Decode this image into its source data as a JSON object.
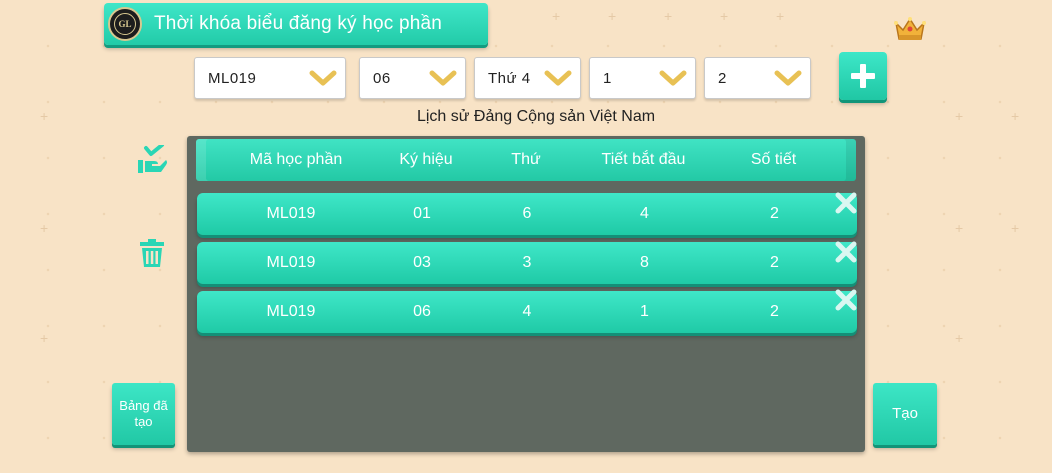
{
  "header": {
    "title": "Thời khóa biểu đăng ký học phần",
    "logo_text": "GL"
  },
  "selects": [
    {
      "value": "ML019"
    },
    {
      "value": "06"
    },
    {
      "value": "Thứ 4"
    },
    {
      "value": "1"
    },
    {
      "value": "2"
    }
  ],
  "course_name": "Lịch sử Đảng Cộng sản Việt Nam",
  "table": {
    "columns": [
      "Mã học phần",
      "Ký hiệu",
      "Thứ",
      "Tiết bắt đầu",
      "Số tiết"
    ],
    "rows": [
      [
        "ML019",
        "01",
        "6",
        "4",
        "2"
      ],
      [
        "ML019",
        "03",
        "3",
        "8",
        "2"
      ],
      [
        "ML019",
        "06",
        "4",
        "1",
        "2"
      ]
    ]
  },
  "buttons": {
    "created_tables": "Bảng đã tạo",
    "create": "Tạo"
  },
  "icons": {
    "crown": "crown-icon",
    "add": "plus-icon",
    "save": "hand-check-icon",
    "delete": "trash-icon",
    "remove_row": "close-icon",
    "dropdown": "chevron-down-icon"
  },
  "colors": {
    "accent": "#2ad6b5",
    "panel": "#5f6860",
    "background": "#f8e3c6",
    "chevron": "#e8c154"
  }
}
